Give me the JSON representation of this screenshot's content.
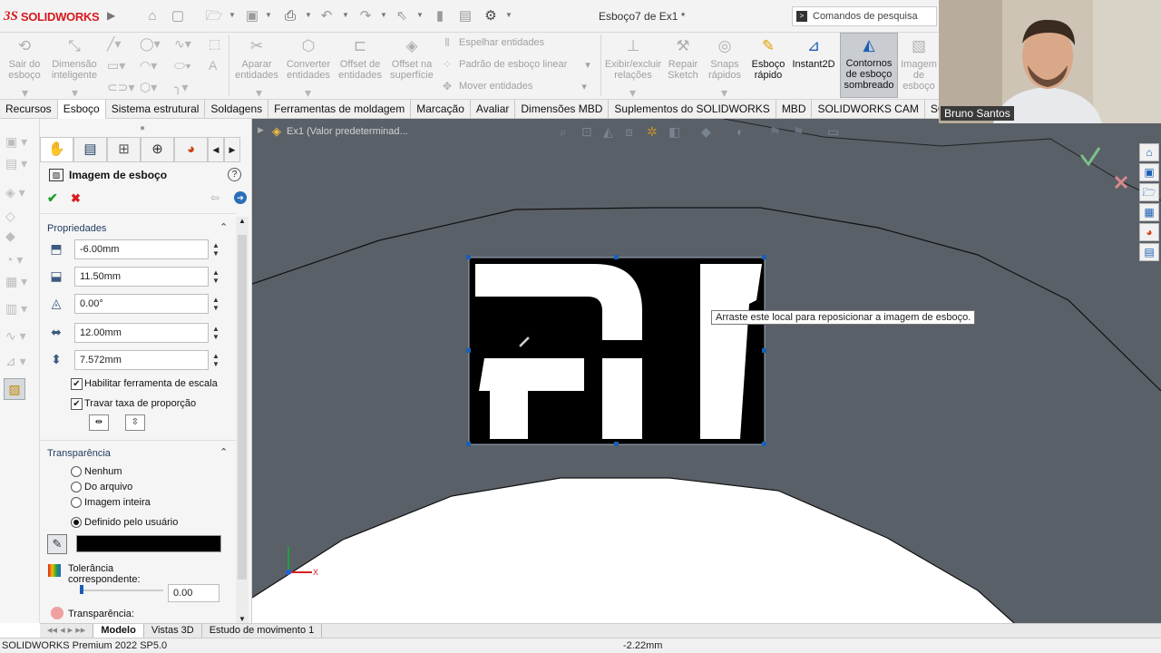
{
  "app": {
    "logo_ds": "3S",
    "logo_text": "SOLIDWORKS",
    "document_title": "Esboço7 de Ex1 *",
    "search_placeholder": "Comandos de pesquisa"
  },
  "ribbon": {
    "sair_do_esboco": "Sair do esboço",
    "dimensao_inteligente": "Dimensão inteligente",
    "aparar_entidades": "Aparar entidades",
    "converter_entidades": "Converter entidades",
    "offset_de_entidades": "Offset de entidades",
    "offset_na_superficie": "Offset na superfície",
    "espelhar_entidades": "Espelhar entidades",
    "padrao_de_esboco_linear": "Padrão de esboço linear",
    "mover_entidades": "Mover entidades",
    "exibir_excluir_relacoes": "Exibir/excluir relações",
    "repair_sketch": "Repair Sketch",
    "snaps_rapidos": "Snaps rápidos",
    "esboco_rapido": "Esboço rápido",
    "instant2d": "Instant2D",
    "contornos_de_esboco_sombreado": "Contornos de esboço sombreado",
    "imagem_de_esboco": "Imagem de esboço"
  },
  "command_tabs": [
    "Recursos",
    "Esboço",
    "Sistema estrutural",
    "Soldagens",
    "Ferramentas de moldagem",
    "Marcação",
    "Avaliar",
    "Dimensões MBD",
    "Suplementos do SOLIDWORKS",
    "MBD",
    "SOLIDWORKS CAM",
    "SOLIDWORKS"
  ],
  "property_manager": {
    "title": "Imagem de esboço",
    "help": "?",
    "ok": "✔",
    "cancel": "✖",
    "propriedades_label": "Propriedades",
    "fields": {
      "x": "-6.00mm",
      "y": "11.50mm",
      "angle": "0.00°",
      "width": "12.00mm",
      "height": "7.572mm"
    },
    "habilitar_escala": "Habilitar ferramenta de escala",
    "travar_proporcao": "Travar taxa de proporção",
    "transparencia_label": "Transparência",
    "radio_nenhum": "Nenhum",
    "radio_do_arquivo": "Do arquivo",
    "radio_imagem_inteira": "Imagem inteira",
    "radio_definido": "Definido pelo usuário",
    "selected_transparency": "Definido pelo usuário",
    "picked_color": "#000000",
    "tolerancia_label": "Tolerância correspondente:",
    "tolerancia_value": "0.00",
    "transparencia_slider_label": "Transparência:"
  },
  "viewport": {
    "tree_item": "Ex1  (Valor predeterminad...",
    "tooltip": "Arraste este local para reposicionar a imagem de esboço.",
    "axis_x": "X"
  },
  "model_tabs": [
    "Modelo",
    "Vistas 3D",
    "Estudo de movimento 1"
  ],
  "status": {
    "product": "SOLIDWORKS Premium 2022 SP5.0",
    "coordinate": "-2.22mm"
  },
  "webcam": {
    "name": "Bruno Santos"
  },
  "colors": {
    "viewport_bg": "#5a6068",
    "accent": "#1a5fb4",
    "brand": "#d71920"
  }
}
